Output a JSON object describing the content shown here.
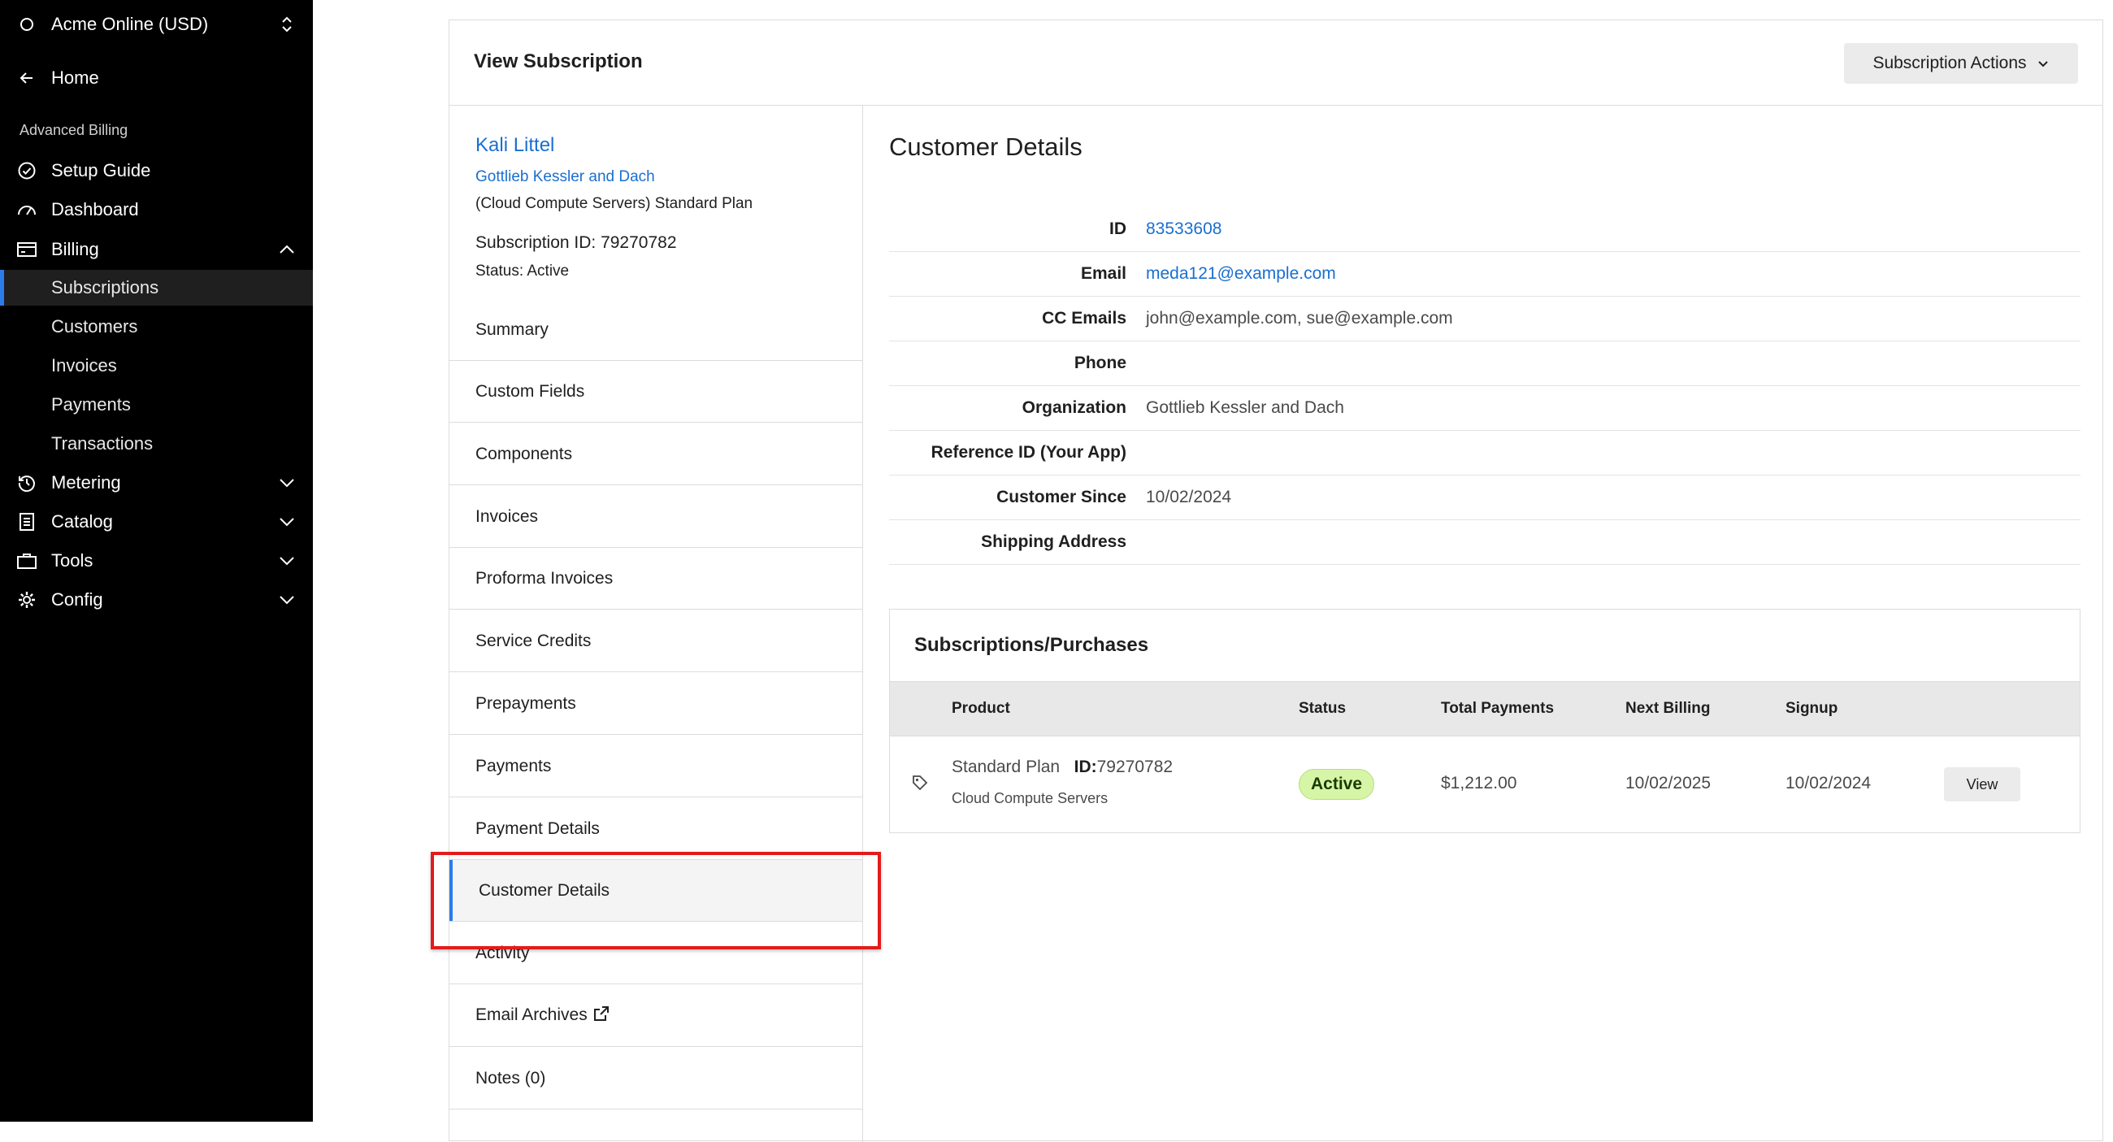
{
  "sidebar": {
    "account": "Acme Online (USD)",
    "home": "Home",
    "section": "Advanced Billing",
    "items": {
      "setup_guide": "Setup Guide",
      "dashboard": "Dashboard",
      "billing": "Billing",
      "subscriptions": "Subscriptions",
      "customers": "Customers",
      "invoices": "Invoices",
      "payments": "Payments",
      "transactions": "Transactions",
      "metering": "Metering",
      "catalog": "Catalog",
      "tools": "Tools",
      "config": "Config"
    }
  },
  "header": {
    "title": "View Subscription",
    "actions_label": "Subscription Actions"
  },
  "customer": {
    "name": "Kali Littel",
    "organization": "Gottlieb Kessler and Dach",
    "plan": "(Cloud Compute Servers) Standard Plan",
    "subscription_id": "Subscription ID: 79270782",
    "status": "Status: Active"
  },
  "nav": {
    "summary": "Summary",
    "custom_fields": "Custom Fields",
    "components": "Components",
    "invoices": "Invoices",
    "proforma_invoices": "Proforma Invoices",
    "service_credits": "Service Credits",
    "prepayments": "Prepayments",
    "payments": "Payments",
    "payment_details": "Payment Details",
    "customer_details": "Customer Details",
    "activity": "Activity",
    "email_archives": "Email Archives",
    "notes": "Notes (0)"
  },
  "details": {
    "title": "Customer Details",
    "rows": [
      {
        "key": "ID",
        "value": "83533608"
      },
      {
        "key": "Email",
        "value": "meda121@example.com"
      },
      {
        "key": "CC Emails",
        "value": "john@example.com, sue@example.com"
      },
      {
        "key": "Phone",
        "value": ""
      },
      {
        "key": "Organization",
        "value": "Gottlieb Kessler and Dach"
      },
      {
        "key": "Reference ID (Your App)",
        "value": ""
      },
      {
        "key": "Customer Since",
        "value": "10/02/2024"
      },
      {
        "key": "Shipping Address",
        "value": ""
      }
    ]
  },
  "subscriptions": {
    "title": "Subscriptions/Purchases",
    "columns": {
      "product": "Product",
      "status": "Status",
      "total_payments": "Total Payments",
      "next_billing": "Next Billing",
      "signup": "Signup"
    },
    "row": {
      "plan": "Standard Plan",
      "id_label": "ID:",
      "id_value": "79270782",
      "family": "Cloud Compute Servers",
      "status": "Active",
      "total_payments": "$1,212.00",
      "next_billing": "10/02/2025",
      "signup": "10/02/2024",
      "view_label": "View"
    }
  },
  "colors": {
    "accent": "#2b7de9",
    "link": "#1a6fd1",
    "highlight": "#e31b1b",
    "badge_bg": "#d7f5a6"
  }
}
